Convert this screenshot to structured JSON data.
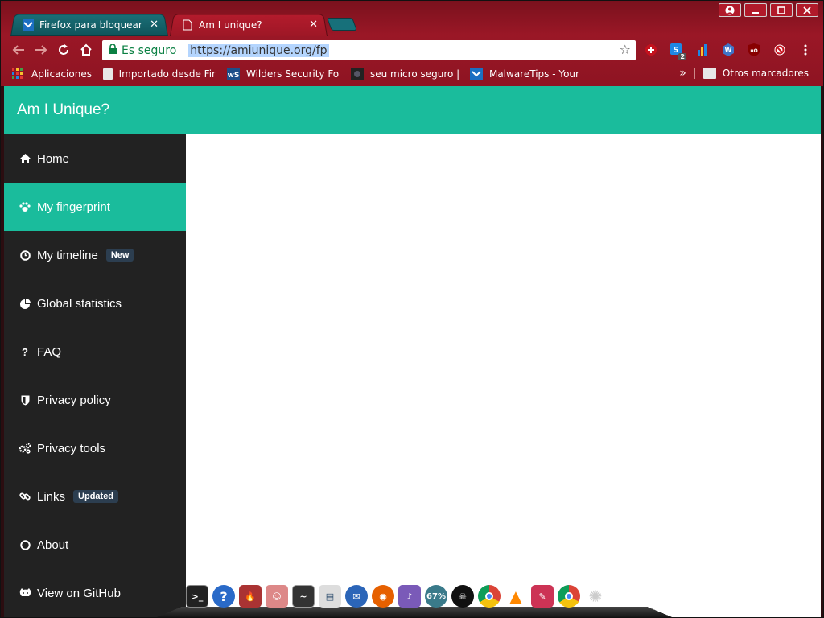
{
  "browser": {
    "tabs": [
      {
        "title": "Firefox para bloquear la",
        "favicon": "malwaretips-icon",
        "active": false
      },
      {
        "title": "Am I unique?",
        "favicon": "page-icon",
        "active": true
      }
    ],
    "close_glyph": "✕",
    "window_controls": [
      "profile",
      "minimize",
      "maximize",
      "close"
    ],
    "omnibox": {
      "secure_label": "Es seguro",
      "url": "https://amiunique.org/fp"
    },
    "extensions": [
      "plus-ext",
      "s-ext",
      "chart-ext",
      "w-ext",
      "ublock-ext",
      "block-ext",
      "menu"
    ],
    "extension_badge": "2",
    "bookmarks": [
      {
        "label": "Aplicaciones",
        "icon": "apps-grid-icon"
      },
      {
        "label": "Importado desde Fir",
        "icon": "folder-icon"
      },
      {
        "label": "Wilders Security For",
        "icon": "wilders-icon"
      },
      {
        "label": "seu micro seguro |",
        "icon": "smseg-icon"
      },
      {
        "label": "MalwareTips - Your",
        "icon": "malwaretips-icon"
      }
    ],
    "bookmarks_overflow": "»",
    "other_bookmarks": "Otros marcadores"
  },
  "site": {
    "brand": "Am I Unique?",
    "colors": {
      "accent": "#1abc9c",
      "sidebar": "#222222",
      "badge": "#2c3e50"
    },
    "nav": [
      {
        "label": "Home",
        "icon": "home-icon",
        "glyph": "⌂",
        "active": false,
        "badge": ""
      },
      {
        "label": "My fingerprint",
        "icon": "paw-icon",
        "glyph": "❀",
        "active": true,
        "badge": ""
      },
      {
        "label": "My timeline",
        "icon": "clock-icon",
        "glyph": "◷",
        "active": false,
        "badge": "New"
      },
      {
        "label": "Global statistics",
        "icon": "pie-chart-icon",
        "glyph": "◕",
        "active": false,
        "badge": ""
      },
      {
        "label": "FAQ",
        "icon": "question-icon",
        "glyph": "?",
        "active": false,
        "badge": ""
      },
      {
        "label": "Privacy policy",
        "icon": "shield-icon",
        "glyph": "⛉",
        "active": false,
        "badge": ""
      },
      {
        "label": "Privacy tools",
        "icon": "gears-icon",
        "glyph": "⚙",
        "active": false,
        "badge": ""
      },
      {
        "label": "Links",
        "icon": "link-icon",
        "glyph": "⚭",
        "active": false,
        "badge": "Updated"
      },
      {
        "label": "About",
        "icon": "circle-icon",
        "glyph": "○",
        "active": false,
        "badge": ""
      },
      {
        "label": "View on GitHub",
        "icon": "github-icon",
        "glyph": "☻",
        "active": false,
        "badge": ""
      }
    ]
  },
  "dock": {
    "items": [
      "terminal-icon",
      "help-icon",
      "fire-icon",
      "user-icon",
      "monitor-icon",
      "files-icon",
      "thunderbird-icon",
      "firefox-icon",
      "pidgin-icon",
      "cpu-icon",
      "hacker-icon",
      "chrome-icon",
      "vlc-icon",
      "editor-icon",
      "chrome-icon",
      "settings-icon"
    ],
    "cpu_label": "67%"
  }
}
